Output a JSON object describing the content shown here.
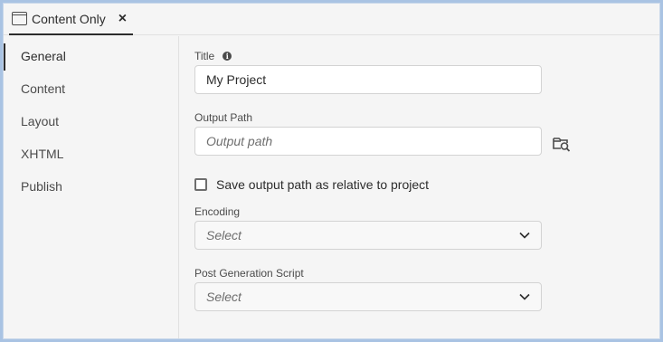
{
  "tab": {
    "label": "Content Only",
    "close": "×"
  },
  "sidebar": {
    "items": [
      {
        "label": "General",
        "active": true
      },
      {
        "label": "Content",
        "active": false
      },
      {
        "label": "Layout",
        "active": false
      },
      {
        "label": "XHTML",
        "active": false
      },
      {
        "label": "Publish",
        "active": false
      }
    ]
  },
  "form": {
    "title": {
      "label": "Title",
      "value": "My Project"
    },
    "output_path": {
      "label": "Output Path",
      "placeholder": "Output path",
      "value": ""
    },
    "relative_checkbox": {
      "label": "Save output path as relative to project",
      "checked": false
    },
    "encoding": {
      "label": "Encoding",
      "selected": "Select"
    },
    "post_script": {
      "label": "Post Generation Script",
      "selected": "Select"
    }
  },
  "colors": {
    "frame": "#a9c3e3",
    "panel": "#f5f5f5",
    "text": "#2c2c2c",
    "muted": "#6e6e6e"
  }
}
